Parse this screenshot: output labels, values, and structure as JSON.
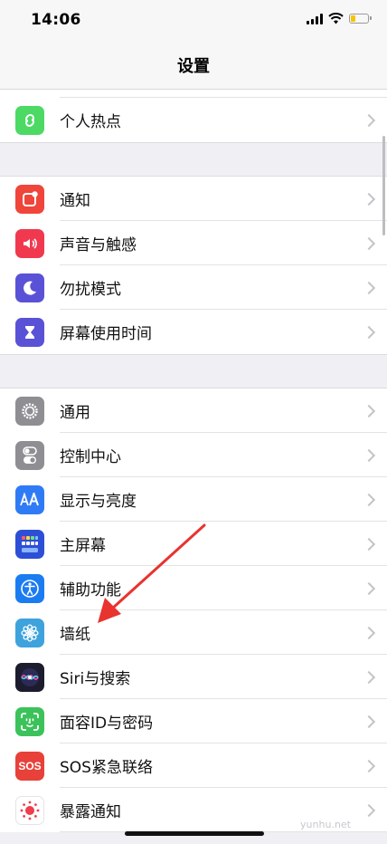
{
  "status_bar": {
    "time": "14:06"
  },
  "nav": {
    "title": "设置"
  },
  "group1": [
    {
      "name": "row-personal-hotspot",
      "label": "个人热点",
      "icon": "hotspot-icon",
      "color": "#4cd964"
    }
  ],
  "group2": [
    {
      "name": "row-notifications",
      "label": "通知",
      "icon": "notification-icon",
      "color": "#f0453a"
    },
    {
      "name": "row-sounds-haptics",
      "label": "声音与触感",
      "icon": "speaker-icon",
      "color": "#f0394f"
    },
    {
      "name": "row-do-not-disturb",
      "label": "勿扰模式",
      "icon": "moon-icon",
      "color": "#5a52d6"
    },
    {
      "name": "row-screen-time",
      "label": "屏幕使用时间",
      "icon": "hourglass-icon",
      "color": "#5a52d6"
    }
  ],
  "group3": [
    {
      "name": "row-general",
      "label": "通用",
      "icon": "gear-icon",
      "color": "#8e8e93"
    },
    {
      "name": "row-control-center",
      "label": "控制中心",
      "icon": "toggle-icon",
      "color": "#8e8e93"
    },
    {
      "name": "row-display-brightness",
      "label": "显示与亮度",
      "icon": "text-size-icon",
      "color": "#2f7bf5"
    },
    {
      "name": "row-home-screen",
      "label": "主屏幕",
      "icon": "grid-icon",
      "color": "#2d4fd6"
    },
    {
      "name": "row-accessibility",
      "label": "辅助功能",
      "icon": "accessibility-icon",
      "color": "#1b7cf2"
    },
    {
      "name": "row-wallpaper",
      "label": "墙纸",
      "icon": "flower-icon",
      "color": "#3ea3dc"
    },
    {
      "name": "row-siri-search",
      "label": "Siri与搜索",
      "icon": "siri-icon",
      "color": "#1c1c2e"
    },
    {
      "name": "row-face-id",
      "label": "面容ID与密码",
      "icon": "face-id-icon",
      "color": "#3cc25a"
    },
    {
      "name": "row-emergency-sos",
      "label": "SOS紧急联络",
      "icon": "sos-icon",
      "color": "#e8413a",
      "badge": "SOS"
    },
    {
      "name": "row-exposure-notifications",
      "label": "暴露通知",
      "icon": "exposure-icon",
      "color": "#ffffff"
    }
  ],
  "watermark": "yunhu.net"
}
